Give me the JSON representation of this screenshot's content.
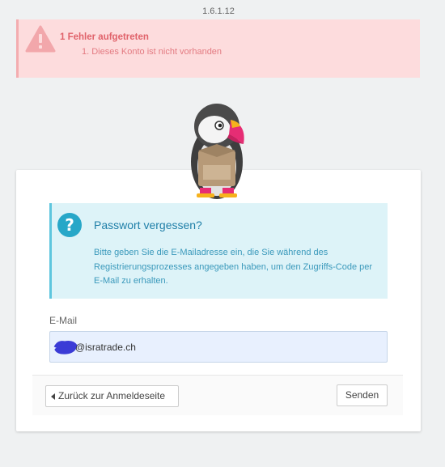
{
  "header": {
    "version": "1.6.1.12"
  },
  "error": {
    "title": "1 Fehler aufgetreten",
    "items": [
      "1. Dieses Konto ist nicht vorhanden"
    ],
    "color": "#e0626a",
    "icon": "warning-icon"
  },
  "mascot": {
    "icon": "puffin-mascot-logo"
  },
  "forgot": {
    "title": "Passwort vergessen?",
    "text": "Bitte geben Sie die E-Mailadresse ein, die Sie während des Registrierungsprozesses angegeben haben, um den Zugriffs-Code per E-Mail zu erhalten.",
    "icon": "question-icon",
    "accent": "#27a7c8"
  },
  "form": {
    "email_label": "E-Mail",
    "email_value": "@isratrade.ch"
  },
  "footer": {
    "back_label": "Zurück zur Anmeldeseite",
    "send_label": "Senden"
  }
}
